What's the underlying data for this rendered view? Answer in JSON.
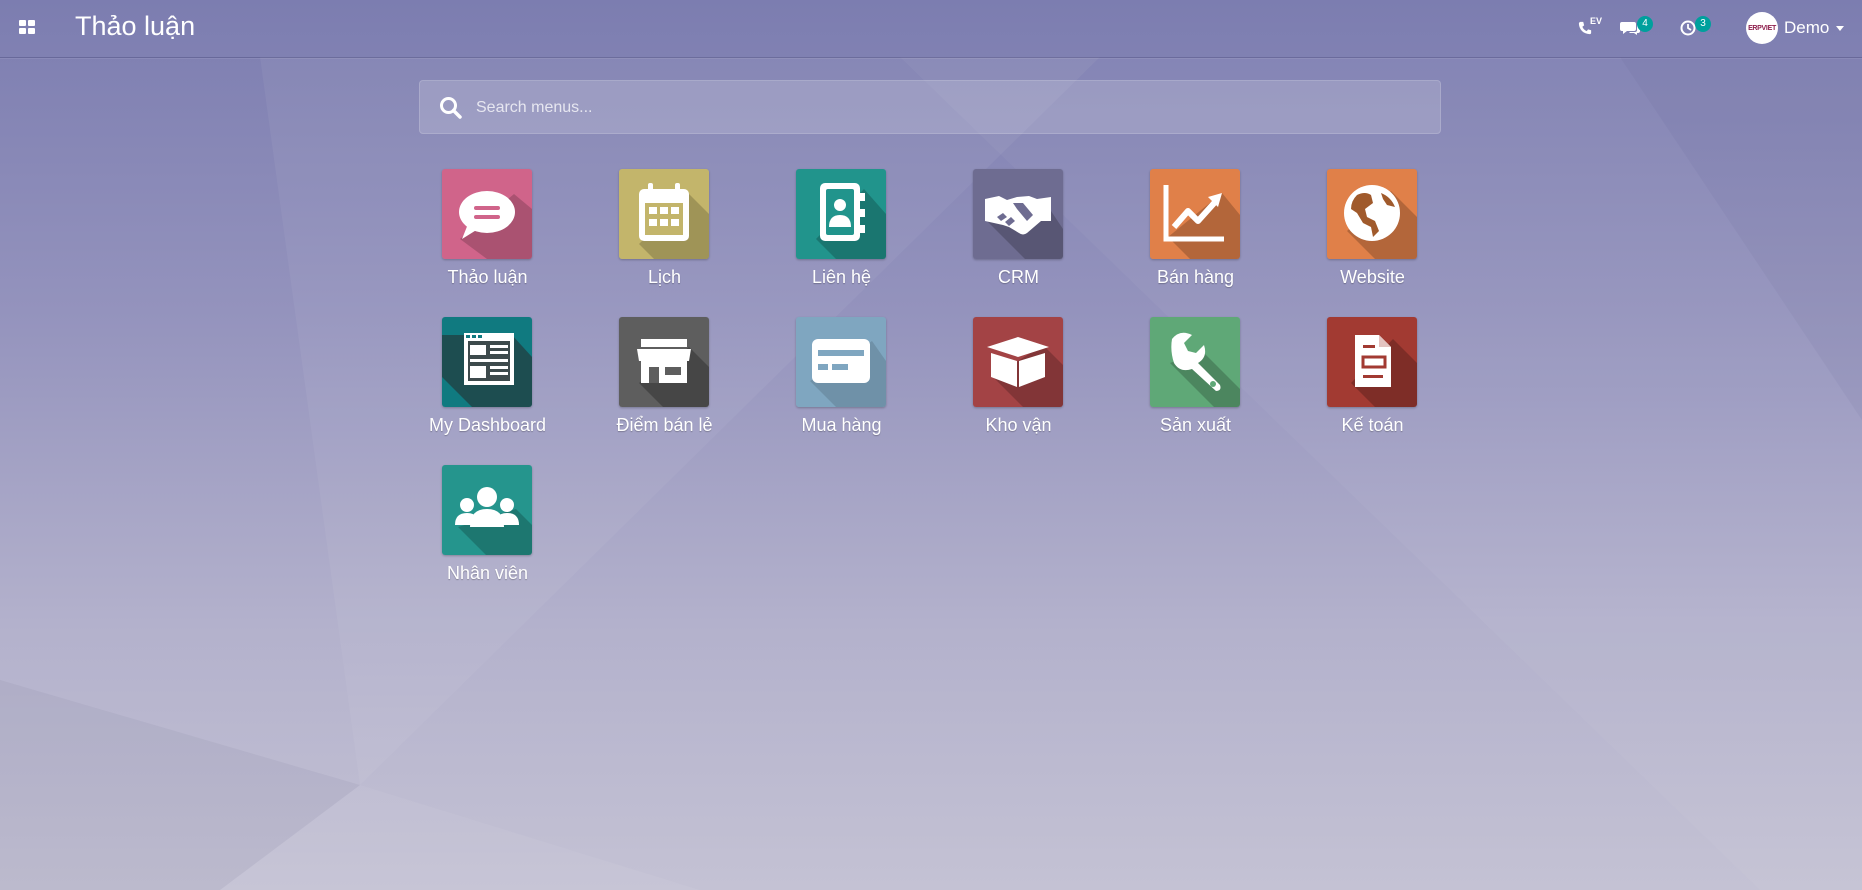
{
  "header": {
    "title": "Thảo luận",
    "apps_menu_icon": "apps-grid-icon",
    "systray": {
      "voip": {
        "icon": "phone-icon",
        "label": "EV"
      },
      "messaging": {
        "icon": "chat-icon",
        "count": "4"
      },
      "activity": {
        "icon": "clock-icon",
        "count": "3"
      }
    },
    "user": {
      "name": "Demo",
      "avatar_text": "ERPVIET"
    }
  },
  "search": {
    "placeholder": "Search menus...",
    "value": ""
  },
  "apps": [
    {
      "label": "Thảo luận",
      "icon": "discuss-chat-bubble-icon",
      "color": "#d0648a"
    },
    {
      "label": "Lịch",
      "icon": "calendar-icon",
      "color": "#c3b56b"
    },
    {
      "label": "Liên hệ",
      "icon": "contacts-address-book-icon",
      "color": "#21948c"
    },
    {
      "label": "CRM",
      "icon": "handshake-icon",
      "color": "#6e6c91"
    },
    {
      "label": "Bán hàng",
      "icon": "sales-chart-icon",
      "color": "#e08049"
    },
    {
      "label": "Website",
      "icon": "globe-icon",
      "color": "#e08049"
    },
    {
      "label": "My Dashboard",
      "icon": "dashboard-icon",
      "color": "#107a80"
    },
    {
      "label": "Điểm bán lẻ",
      "icon": "store-icon",
      "color": "#5e5e5e"
    },
    {
      "label": "Mua hàng",
      "icon": "credit-card-icon",
      "color": "#7fa6c0"
    },
    {
      "label": "Kho vận",
      "icon": "box-icon",
      "color": "#a34345"
    },
    {
      "label": "Sản xuất",
      "icon": "wrench-icon",
      "color": "#5fa877"
    },
    {
      "label": "Kế toán",
      "icon": "invoice-document-icon",
      "color": "#a23a32"
    },
    {
      "label": "Nhân viên",
      "icon": "team-users-icon",
      "color": "#25958d"
    }
  ]
}
